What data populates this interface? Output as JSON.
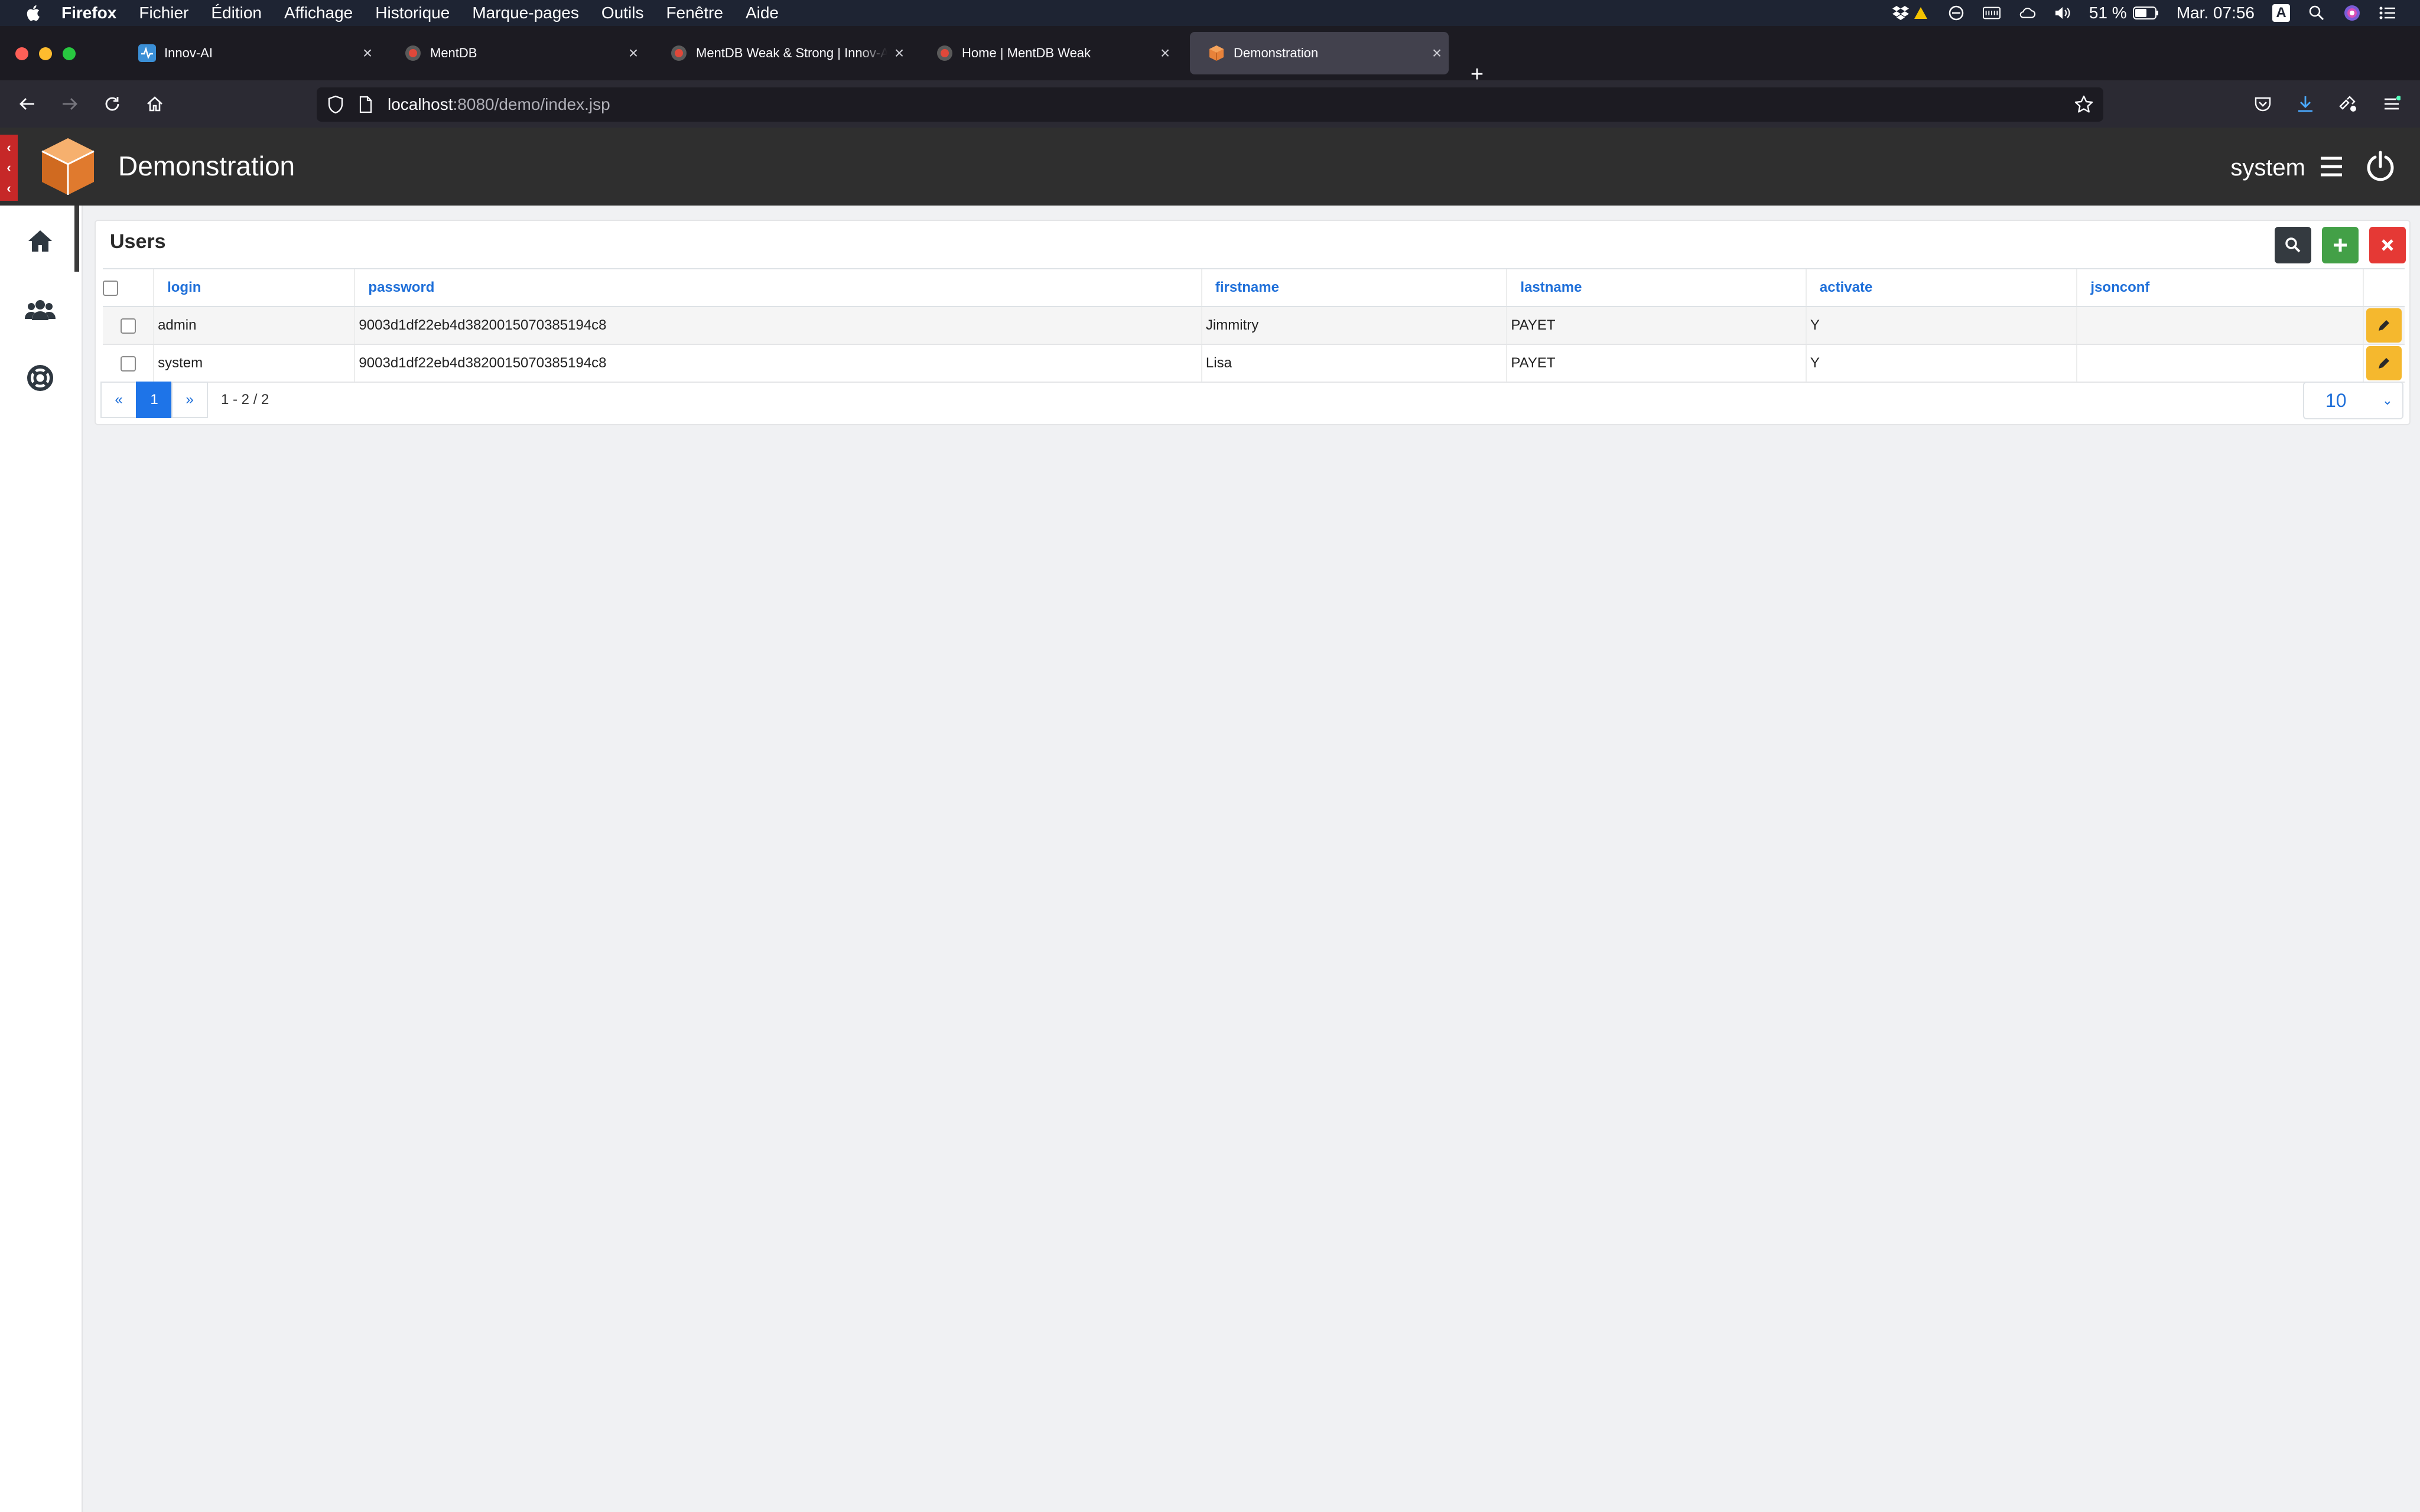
{
  "menubar": {
    "app_name": "Firefox",
    "items": [
      "Fichier",
      "Édition",
      "Affichage",
      "Historique",
      "Marque-pages",
      "Outils",
      "Fenêtre",
      "Aide"
    ],
    "battery": "51 %",
    "clock": "Mar. 07:56",
    "input_source": "A"
  },
  "tabs": [
    {
      "label": "Innov-AI",
      "icon": "innov-ai-icon",
      "close": "×"
    },
    {
      "label": "MentDB",
      "icon": "mentdb-icon",
      "close": "×"
    },
    {
      "label": "MentDB Weak & Strong | Innov-AI",
      "icon": "mentdb-icon",
      "close": "×"
    },
    {
      "label": "Home | MentDB Weak",
      "icon": "mentdb-icon",
      "close": "×"
    },
    {
      "label": "Demonstration",
      "icon": "cube-icon",
      "close": "×"
    }
  ],
  "new_tab": "+",
  "urlbar": {
    "host": "localhost",
    "rest": ":8080/demo/index.jsp"
  },
  "app": {
    "title": "Demonstration",
    "user": "system",
    "toggle_glyphs": [
      "‹",
      "‹",
      "‹"
    ]
  },
  "users_card": {
    "title": "Users",
    "columns": [
      "login",
      "password",
      "firstname",
      "lastname",
      "activate",
      "jsonconf"
    ],
    "rows": [
      {
        "login": "admin",
        "password": "9003d1df22eb4d3820015070385194c8",
        "firstname": "Jimmitry",
        "lastname": "PAYET",
        "activate": "Y",
        "jsonconf": ""
      },
      {
        "login": "system",
        "password": "9003d1df22eb4d3820015070385194c8",
        "firstname": "Lisa",
        "lastname": "PAYET",
        "activate": "Y",
        "jsonconf": ""
      }
    ],
    "pagination": {
      "prev": "«",
      "current": "1",
      "next": "»",
      "info": "1 - 2 / 2"
    },
    "page_size": "10"
  },
  "colors": {
    "accent": "#1e74e8",
    "add": "#43a047",
    "delete": "#e53935",
    "edit": "#f5b82e",
    "header": "#2f2f2f"
  }
}
